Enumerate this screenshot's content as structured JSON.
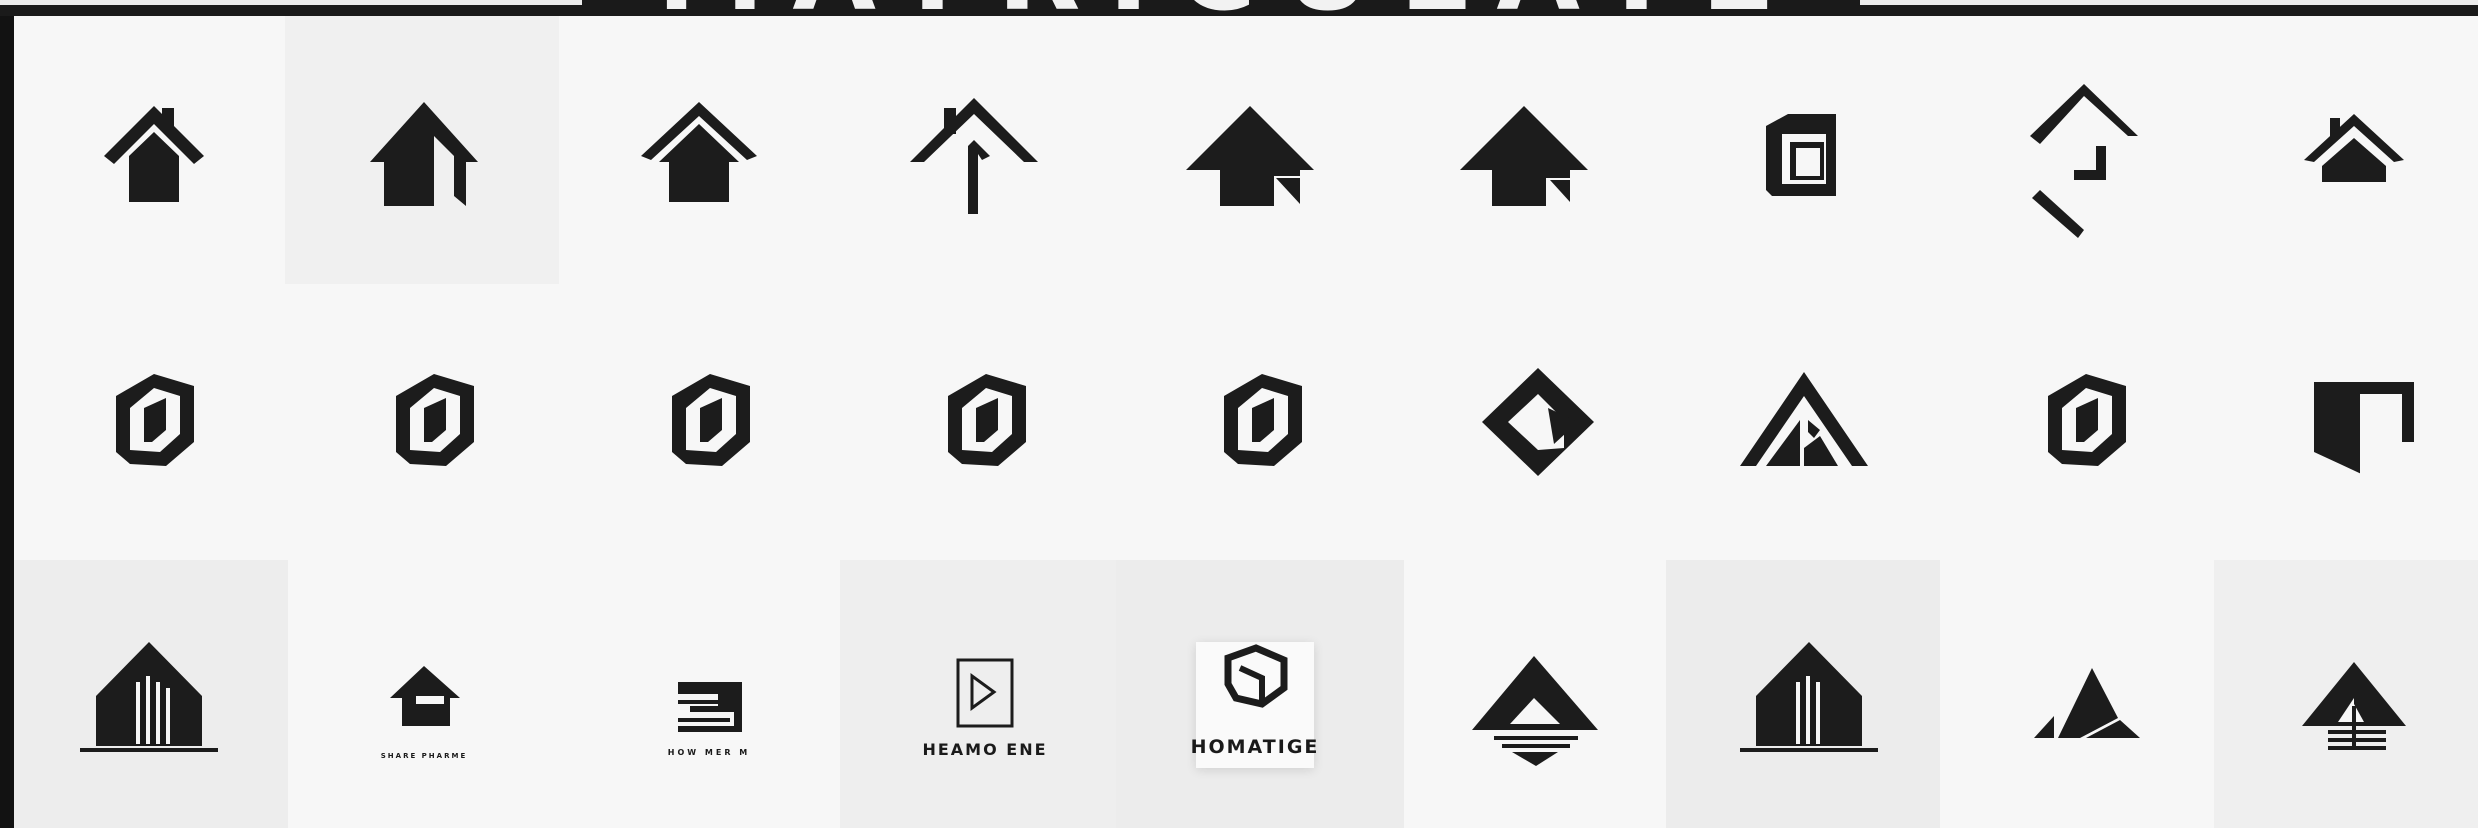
{
  "banner": {
    "text": "MATRICULATE"
  },
  "colors": {
    "background": "#f7f7f7",
    "ink": "#1c1c1c",
    "frame": "#121212",
    "tile_gray": "#efefef"
  },
  "logo_grid": {
    "rows": 3,
    "columns": 9,
    "row1": [
      {
        "icon": "house-chimney-icon"
      },
      {
        "icon": "house-split-arrow-icon"
      },
      {
        "icon": "house-double-roof-icon"
      },
      {
        "icon": "arrow-up-chimney-icon"
      },
      {
        "icon": "house-folded-corner-icon"
      },
      {
        "icon": "house-notch-icon"
      },
      {
        "icon": "box-frame-icon"
      },
      {
        "icon": "broken-diamond-icon"
      },
      {
        "icon": "small-house-chimney-icon"
      }
    ],
    "row2": [
      {
        "icon": "hexagon-box-icon"
      },
      {
        "icon": "hexagon-box-icon"
      },
      {
        "icon": "hexagon-box-icon"
      },
      {
        "icon": "hexagon-box-icon"
      },
      {
        "icon": "hexagon-box-icon"
      },
      {
        "icon": "diamond-arrow-icon"
      },
      {
        "icon": "triangle-roof-icon"
      },
      {
        "icon": "hexagon-box-icon"
      },
      {
        "icon": "folded-block-icon"
      }
    ],
    "row3": [
      {
        "icon": "house-columns-icon",
        "label": ""
      },
      {
        "icon": "small-house-icon",
        "label": "SHARE PHARME"
      },
      {
        "icon": "stacked-box-icon",
        "label": "HOW MER M"
      },
      {
        "icon": "play-frame-icon",
        "label": "HEAMO ENE"
      },
      {
        "icon": "cube-outline-icon",
        "label": "HOMATIGE"
      },
      {
        "icon": "triangle-stripes-icon",
        "label": ""
      },
      {
        "icon": "house-columns-icon",
        "label": ""
      },
      {
        "icon": "split-triangle-icon",
        "label": ""
      },
      {
        "icon": "house-striped-icon",
        "label": ""
      }
    ]
  }
}
